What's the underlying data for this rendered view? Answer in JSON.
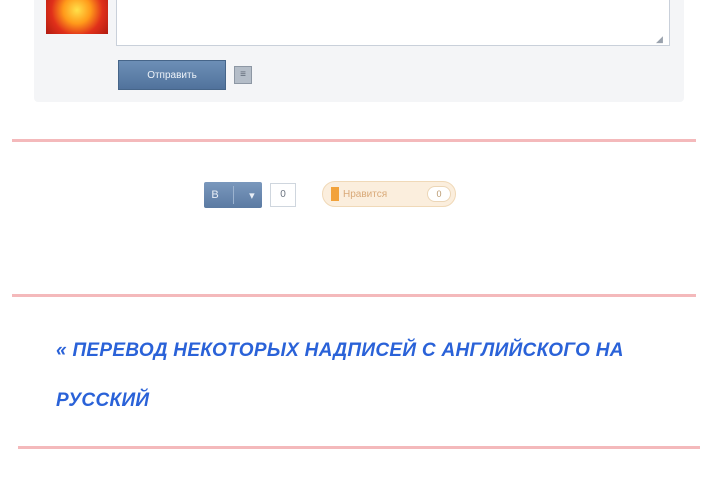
{
  "comment_form": {
    "textarea_value": "",
    "send_label": "Отправить",
    "options_glyph": "≡",
    "avatar_icon": "user-avatar-flame"
  },
  "share": {
    "vk_glyph": "В",
    "vk_arrow": "▾",
    "count": "0",
    "like_label": "Нравится",
    "like_count": "0"
  },
  "related": {
    "link_text": "« Перевод некоторых надписей с английского на русский"
  },
  "colors": {
    "divider": "#f4b9bb",
    "button": "#5b7aa2",
    "link": "#2a62d8",
    "like_bg": "#fbeedd"
  }
}
